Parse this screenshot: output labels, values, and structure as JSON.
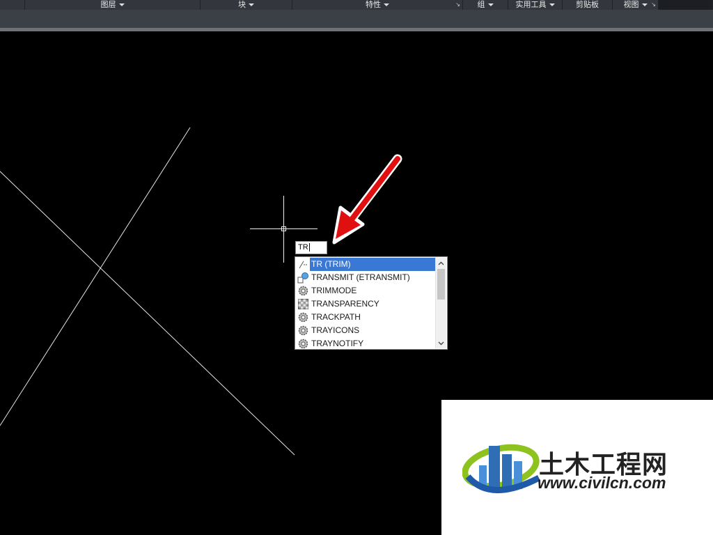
{
  "ribbon": {
    "panels": [
      "图层",
      "块",
      "特性",
      "组",
      "实用工具",
      "剪贴板",
      "视图"
    ]
  },
  "command": {
    "typed": "TR"
  },
  "autocomplete": {
    "items": [
      {
        "label": "TR (TRIM)",
        "icon": "trim-icon",
        "selected": true
      },
      {
        "label": "TRANSMIT (ETRANSMIT)",
        "icon": "transmit-icon",
        "selected": false
      },
      {
        "label": "TRIMMODE",
        "icon": "gear-icon",
        "selected": false
      },
      {
        "label": "TRANSPARENCY",
        "icon": "transparency-icon",
        "selected": false
      },
      {
        "label": "TRACKPATH",
        "icon": "gear-icon",
        "selected": false
      },
      {
        "label": "TRAYICONS",
        "icon": "gear-icon",
        "selected": false
      },
      {
        "label": "TRAYNOTIFY",
        "icon": "gear-icon",
        "selected": false
      }
    ]
  },
  "watermark": {
    "name_cn": "土木工程网",
    "url": "www.civilcn.com"
  },
  "colors": {
    "canvas": "#000000",
    "lines": "#e6e6e6",
    "selection": "#3a78d6",
    "arrow": "#e01010"
  }
}
